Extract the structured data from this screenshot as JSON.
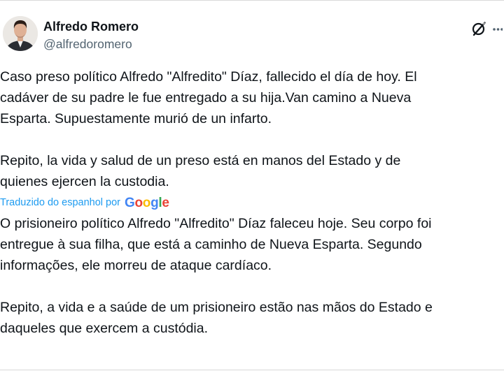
{
  "author": {
    "display_name": "Alfredo Romero",
    "handle": "@alfredoromero"
  },
  "icons": {
    "grok": "grok-icon",
    "more": "more-options-icon"
  },
  "post": {
    "original_lines": [
      "Caso preso político Alfredo \"Alfredito\" Díaz, fallecido el día de hoy. El",
      "cadáver de su padre le fue entregado a su hija.Van camino a Nueva",
      "Esparta. Supuestamente murió de un infarto.",
      "Repito, la vida y salud de un preso está en manos del Estado y de",
      "quienes ejercen la custodia."
    ],
    "translated_by_label": "Traduzido do espanhol por",
    "translator_brand": "Google",
    "translation_lines": [
      "O prisioneiro político Alfredo \"Alfredito\" Díaz faleceu hoje. Seu corpo foi",
      "entregue à sua filha, que está a caminho de Nueva Esparta. Segundo",
      "informações, ele morreu de ataque cardíaco.",
      "Repito, a vida e a saúde de um prisioneiro estão nas mãos do Estado e",
      "daqueles que exercem a custódia."
    ]
  },
  "colors": {
    "text": "#0f1419",
    "secondary": "#536471",
    "link": "#1d9bf0",
    "google_blue": "#4285F4",
    "google_red": "#EA4335",
    "google_yellow": "#FBBC05",
    "google_green": "#34A853"
  }
}
